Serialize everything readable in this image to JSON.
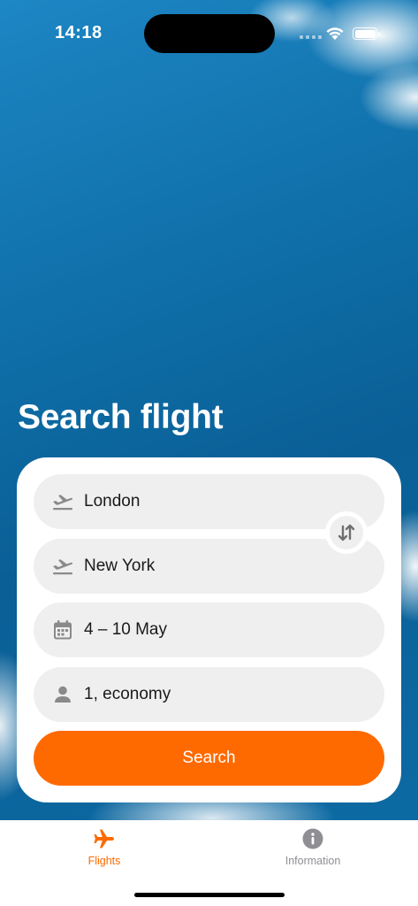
{
  "status_bar": {
    "time": "14:18"
  },
  "title": "Search flight",
  "form": {
    "from": "London",
    "to": "New York",
    "dates": "4 – 10 May",
    "passengers": "1, economy",
    "search_label": "Search"
  },
  "tabs": [
    {
      "label": "Flights",
      "icon": "airplane-icon",
      "active": true
    },
    {
      "label": "Information",
      "icon": "info-icon",
      "active": false
    }
  ],
  "colors": {
    "accent": "#ff6a00",
    "field_bg": "#efefef",
    "sky": "#0f6fa8"
  }
}
